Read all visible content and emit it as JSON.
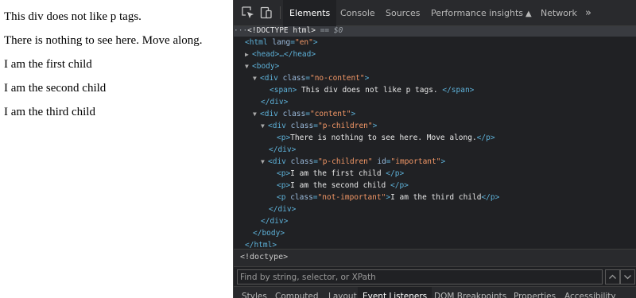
{
  "page": {
    "lines": [
      "This div does not like p tags.",
      "There is nothing to see here. Move along.",
      "I am the first child",
      "I am the second child",
      "I am the third child"
    ]
  },
  "devtools": {
    "tabs": [
      "Elements",
      "Console",
      "Sources",
      "Performance insights",
      "Network"
    ],
    "active_tab": "Elements",
    "overflow": "»",
    "dom": {
      "doctype": "<!DOCTYPE html>",
      "doctype_eq": "== $0",
      "html_tag_open": "<html",
      "html_attr": "lang",
      "html_val": "\"en\"",
      "head": "<head>…</head>",
      "body_open": "<body>",
      "div_open": "<div",
      "class_attr": "class",
      "id_attr": "id",
      "no_content_val": "\"no-content\"",
      "span_open": "<span>",
      "span_text": " This div does not like p tags. ",
      "span_close": "</span>",
      "div_close": "</div>",
      "content_val": "\"content\"",
      "p_children_val": "\"p-children\"",
      "p_open": "<p>",
      "p_close": "</p>",
      "p_nothing_text": "There is nothing to see here. Move along.",
      "important_val": "\"important\"",
      "p_first_text": "I am the first child ",
      "p_second_text": "I am the second child ",
      "p_class_open": "<p",
      "not_important_val": "\"not-important\"",
      "p_third_text": "I am the third child",
      "body_close": "</body>",
      "html_close": "</html>"
    },
    "breadcrumb": "<!doctype>",
    "search": {
      "placeholder": "Find by string, selector, or XPath",
      "up": "˄",
      "down": "˅"
    },
    "bottom_tabs": [
      "Styles",
      "Computed",
      "Layout",
      "Event Listeners",
      "DOM Breakpoints",
      "Properties",
      "Accessibility"
    ],
    "active_bottom_tab": "Event Listeners"
  }
}
